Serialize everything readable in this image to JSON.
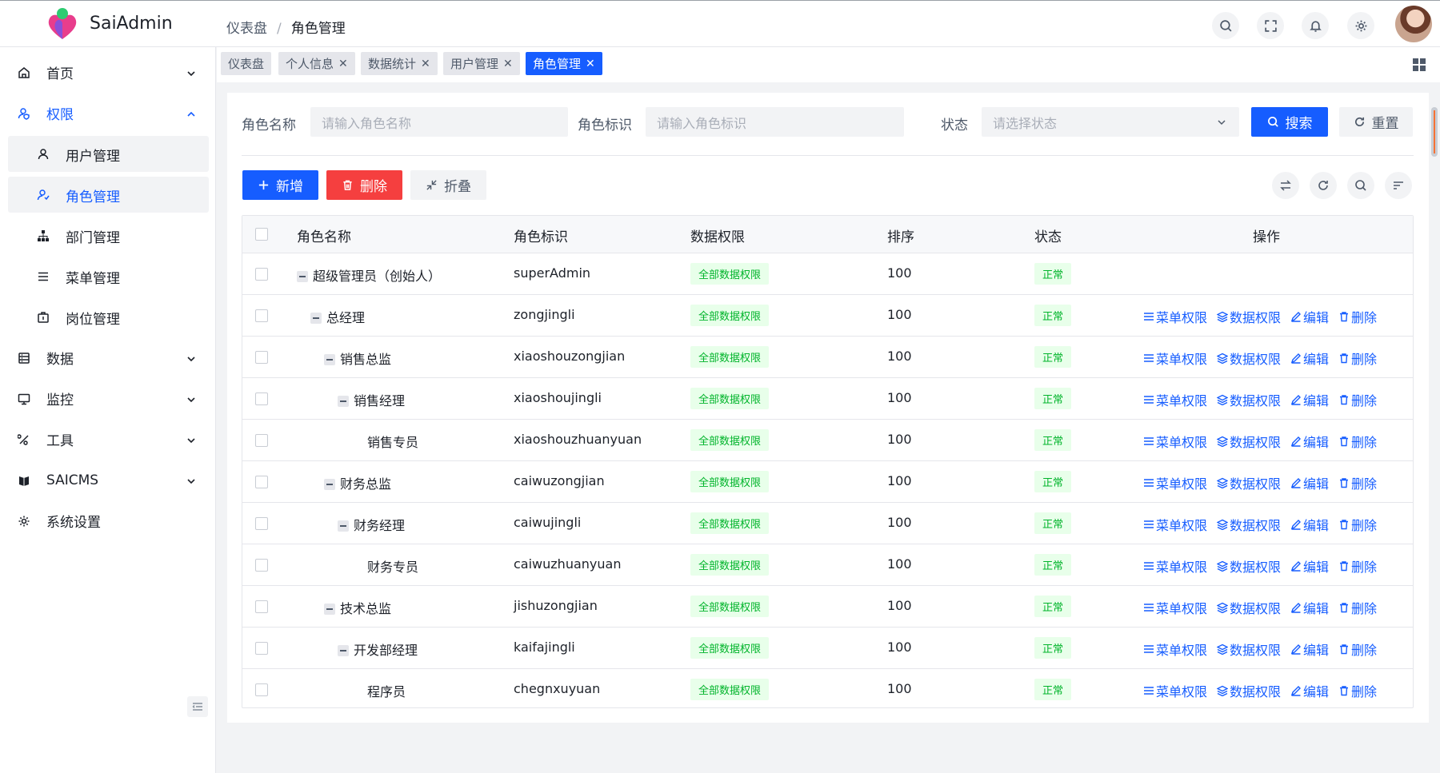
{
  "app": {
    "brand": "SaiAdmin"
  },
  "breadcrumb": {
    "home": "仪表盘",
    "current": "角色管理"
  },
  "header_icons": [
    "search-icon",
    "fullscreen-icon",
    "bell-icon",
    "gear-icon"
  ],
  "sidebar": {
    "items": [
      {
        "label": "首页",
        "icon": "home-icon"
      },
      {
        "label": "权限",
        "icon": "user-shield-icon"
      },
      {
        "label": "用户管理",
        "icon": "user-icon"
      },
      {
        "label": "角色管理",
        "icon": "role-icon"
      },
      {
        "label": "部门管理",
        "icon": "org-chart-icon"
      },
      {
        "label": "菜单管理",
        "icon": "menu-icon"
      },
      {
        "label": "岗位管理",
        "icon": "post-icon"
      },
      {
        "label": "数据",
        "icon": "database-icon"
      },
      {
        "label": "监控",
        "icon": "monitor-icon"
      },
      {
        "label": "工具",
        "icon": "tools-icon"
      },
      {
        "label": "SAICMS",
        "icon": "cms-icon"
      },
      {
        "label": "系统设置",
        "icon": "settings-icon"
      }
    ]
  },
  "tabs": [
    {
      "label": "仪表盘"
    },
    {
      "label": "个人信息"
    },
    {
      "label": "数据统计"
    },
    {
      "label": "用户管理"
    },
    {
      "label": "角色管理"
    }
  ],
  "filters": {
    "role_name_label": "角色名称",
    "role_name_placeholder": "请输入角色名称",
    "role_code_label": "角色标识",
    "role_code_placeholder": "请输入角色标识",
    "status_label": "状态",
    "status_placeholder": "请选择状态",
    "search_label": "搜索",
    "reset_label": "重置"
  },
  "toolbar": {
    "add_label": "新增",
    "delete_label": "删除",
    "fold_label": "折叠"
  },
  "table": {
    "headers": {
      "name": "角色名称",
      "code": "角色标识",
      "data_scope": "数据权限",
      "sort": "排序",
      "status": "状态",
      "actions": "操作"
    },
    "action_labels": {
      "menu": "菜单权限",
      "data": "数据权限",
      "edit": "编辑",
      "delete": "删除"
    },
    "rows": [
      {
        "name": "超级管理员（创始人）",
        "code": "superAdmin",
        "scope": "全部数据权限",
        "sort": "100",
        "status": "正常"
      },
      {
        "name": "总经理",
        "code": "zongjingli",
        "scope": "全部数据权限",
        "sort": "100",
        "status": "正常"
      },
      {
        "name": "销售总监",
        "code": "xiaoshouzongjian",
        "scope": "全部数据权限",
        "sort": "100",
        "status": "正常"
      },
      {
        "name": "销售经理",
        "code": "xiaoshoujingli",
        "scope": "全部数据权限",
        "sort": "100",
        "status": "正常"
      },
      {
        "name": "销售专员",
        "code": "xiaoshouzhuanyuan",
        "scope": "全部数据权限",
        "sort": "100",
        "status": "正常"
      },
      {
        "name": "财务总监",
        "code": "caiwuzongjian",
        "scope": "全部数据权限",
        "sort": "100",
        "status": "正常"
      },
      {
        "name": "财务经理",
        "code": "caiwujingli",
        "scope": "全部数据权限",
        "sort": "100",
        "status": "正常"
      },
      {
        "name": "财务专员",
        "code": "caiwuzhuanyuan",
        "scope": "全部数据权限",
        "sort": "100",
        "status": "正常"
      },
      {
        "name": "技术总监",
        "code": "jishuzongjian",
        "scope": "全部数据权限",
        "sort": "100",
        "status": "正常"
      },
      {
        "name": "开发部经理",
        "code": "kaifajingli",
        "scope": "全部数据权限",
        "sort": "100",
        "status": "正常"
      },
      {
        "name": "程序员",
        "code": "chegnxuyuan",
        "scope": "全部数据权限",
        "sort": "100",
        "status": "正常"
      }
    ]
  },
  "colors": {
    "primary": "#165dff",
    "danger": "#f53f3f",
    "success": "#00b42a",
    "success_bg": "#e8ffea"
  }
}
